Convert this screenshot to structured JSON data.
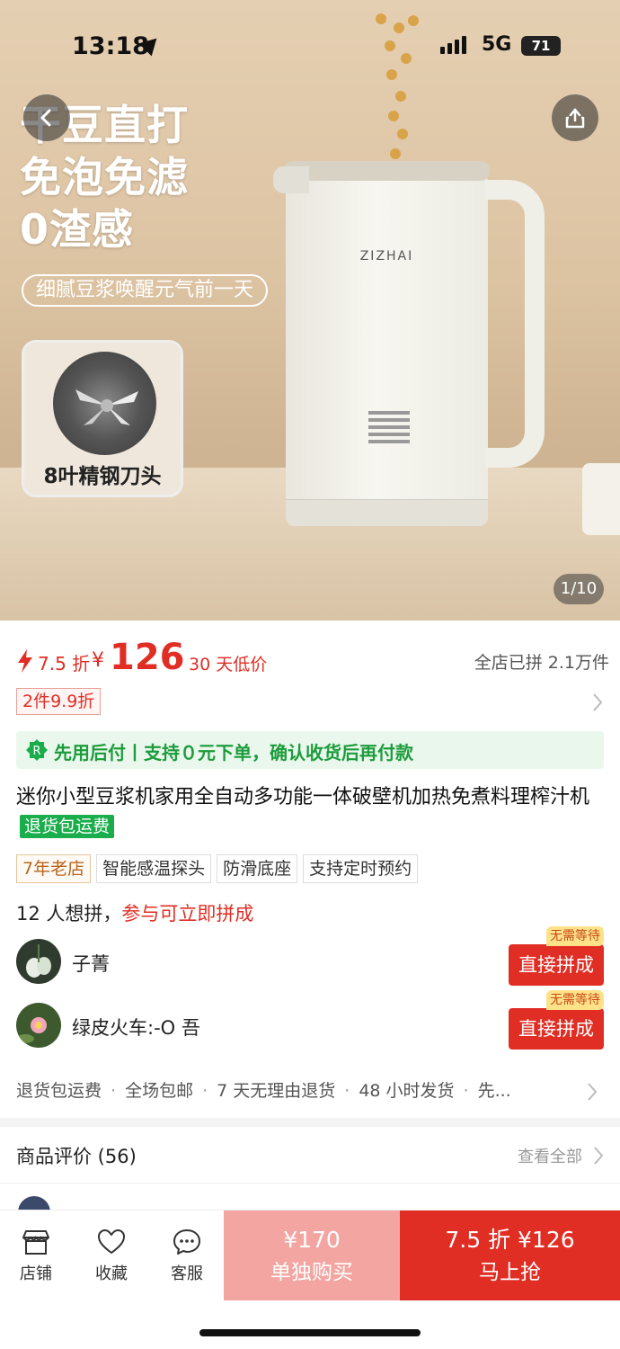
{
  "status_bar": {
    "time": "13:18",
    "network": "5G",
    "battery": "71"
  },
  "hero": {
    "headline_lines": [
      "干豆直打",
      "免泡免滤",
      "0渣感"
    ],
    "tagline": "细腻豆浆唤醒元气前一天",
    "feature_badge": "8叶精钢刀头",
    "brand": "ZIZHAI",
    "image_counter": "1/10"
  },
  "price": {
    "discount": "7.5 折",
    "currency": "¥",
    "amount": "126",
    "low_price_note": "30 天低价",
    "sold_count": "全店已拼 2.1万件"
  },
  "coupon": {
    "label": "2件9.9折"
  },
  "pay_later": {
    "text": "先用后付丨支持０元下单，确认收货后再付款"
  },
  "product": {
    "title": "迷你小型豆浆机家用全自动多功能一体破壁机加热免煮料理榨汁机",
    "return_tag": "退货包运费",
    "chips": [
      "7年老店",
      "智能感温探头",
      "防滑底座",
      "支持定时预约"
    ]
  },
  "group_buy": {
    "want_count": "12 人想拼，",
    "join_text": "参与可立即拼成",
    "rows": [
      {
        "name": "子菁",
        "button": "直接拼成",
        "badge": "无需等待"
      },
      {
        "name": "绿皮火车:-O 吾",
        "button": "直接拼成",
        "badge": "无需等待"
      }
    ]
  },
  "services": [
    "退货包运费",
    "全场包邮",
    "7 天无理由退货",
    "48 小时发货",
    "先..."
  ],
  "reviews": {
    "heading": "商品评价 (56)",
    "view_all": "查看全部"
  },
  "bottom_bar": {
    "store": "店铺",
    "favorite": "收藏",
    "service": "客服",
    "alone_price": "¥170",
    "alone_label": "单独购买",
    "group_price": "7.5 折 ¥126",
    "group_label": "马上抢"
  },
  "colors": {
    "accent": "#e02e24",
    "green": "#1aad4c",
    "light_pink": "#f3a5a1"
  }
}
